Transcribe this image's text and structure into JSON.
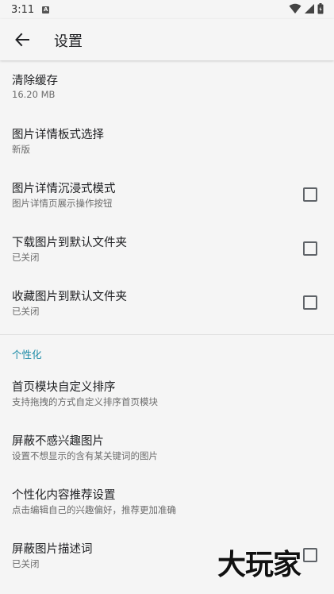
{
  "status_bar": {
    "time": "3:11",
    "notification_glyph": "A",
    "icons": [
      "wifi-icon",
      "signal-icon",
      "battery-icon"
    ]
  },
  "app_bar": {
    "title": "设置",
    "back_icon": "arrow-left-icon"
  },
  "colors": {
    "accent": "#1a8aa6",
    "background": "#f5f5f5",
    "divider": "#dcdcdc"
  },
  "preferences": [
    {
      "title": "清除缓存",
      "summary": "16.20 MB",
      "checkbox": false
    },
    {
      "title": "图片详情板式选择",
      "summary": "新版",
      "checkbox": false
    },
    {
      "title": "图片详情沉浸式模式",
      "summary": "图片详情页展示操作按钮",
      "checkbox": true,
      "checked": false
    },
    {
      "title": "下载图片到默认文件夹",
      "summary": "已关闭",
      "checkbox": true,
      "checked": false
    },
    {
      "title": "收藏图片到默认文件夹",
      "summary": "已关闭",
      "checkbox": true,
      "checked": false
    }
  ],
  "category": {
    "title": "个性化"
  },
  "personal_preferences": [
    {
      "title": "首页模块自定义排序",
      "summary": "支持拖拽的方式自定义排序首页模块"
    },
    {
      "title": "屏蔽不感兴趣图片",
      "summary": "设置不想显示的含有某关键词的图片"
    },
    {
      "title": "个性化内容推荐设置",
      "summary": "点击编辑自己的兴趣偏好，推荐更加准确"
    },
    {
      "title": "屏蔽图片描述词",
      "summary": "已关闭",
      "checkbox": true,
      "checked": false
    }
  ],
  "watermark": "大玩家"
}
